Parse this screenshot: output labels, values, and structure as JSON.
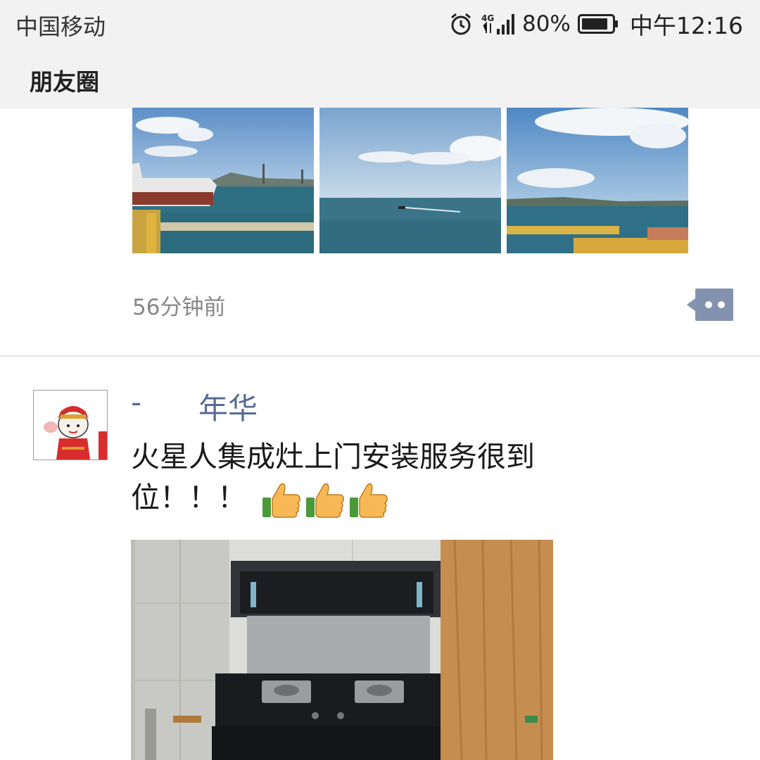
{
  "status_bar": {
    "carrier": "中国移动",
    "network": "4G",
    "battery_percent": "80%",
    "time": "中午12:16",
    "icons": [
      "alarm-icon",
      "signal-icon",
      "battery-icon"
    ]
  },
  "nav": {
    "title": "朋友圈"
  },
  "previous_post": {
    "photos": [
      {
        "name": "harbor-photo-1"
      },
      {
        "name": "sea-photo-2"
      },
      {
        "name": "coast-photo-3"
      }
    ],
    "time_ago": "56分钟前",
    "comment_icon": "comment-icon"
  },
  "post": {
    "author_prefix": "-",
    "author_name": "年华",
    "text": "火星人集成灶上门安装服务很到位！！！",
    "emoji": [
      "thumbs-up-icon",
      "thumbs-up-icon",
      "thumbs-up-icon"
    ],
    "image": "kitchen-stove-photo"
  },
  "colors": {
    "link_blue": "#576b95",
    "header_bg": "#f2f2f2"
  }
}
